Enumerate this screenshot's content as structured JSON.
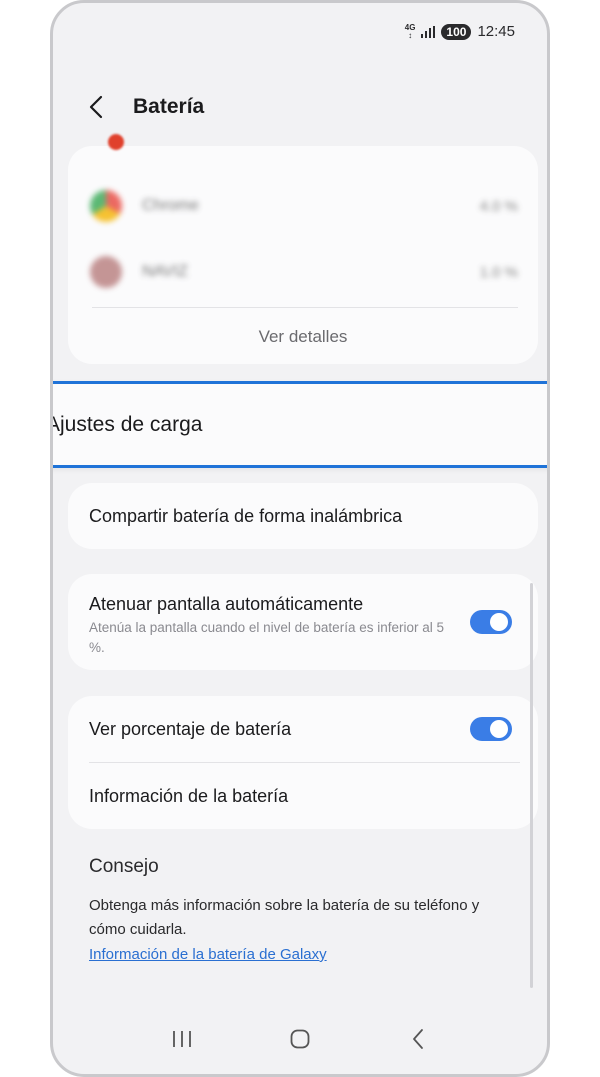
{
  "status_bar": {
    "network": "4G",
    "battery": "100",
    "time": "12:45"
  },
  "header": {
    "title": "Batería"
  },
  "usage": {
    "apps": [
      {
        "name": "Chrome",
        "percent": "4.0 %",
        "color": "#3b9a3c"
      },
      {
        "name": "NAVIZ",
        "percent": "1.0 %",
        "color": "#b77c7c"
      }
    ],
    "details_label": "Ver detalles"
  },
  "charging_settings": {
    "label": "Ajustes de carga"
  },
  "wireless_share": {
    "label": "Compartir batería de forma inalámbrica"
  },
  "auto_dim": {
    "title": "Atenuar pantalla automáticamente",
    "subtitle": "Atenúa la pantalla cuando el nivel de batería es inferior al 5 %.",
    "enabled": true
  },
  "battery_percentage": {
    "label": "Ver porcentaje de batería",
    "enabled": true
  },
  "battery_info": {
    "label": "Información de la batería"
  },
  "tip": {
    "title": "Consejo",
    "text": "Obtenga más información sobre la batería de su teléfono y cómo cuidarla.",
    "link": "Información de la batería de Galaxy"
  },
  "colors": {
    "accent": "#1f73d8",
    "switch_on": "#3a7de6",
    "link": "#2a6fd1"
  }
}
